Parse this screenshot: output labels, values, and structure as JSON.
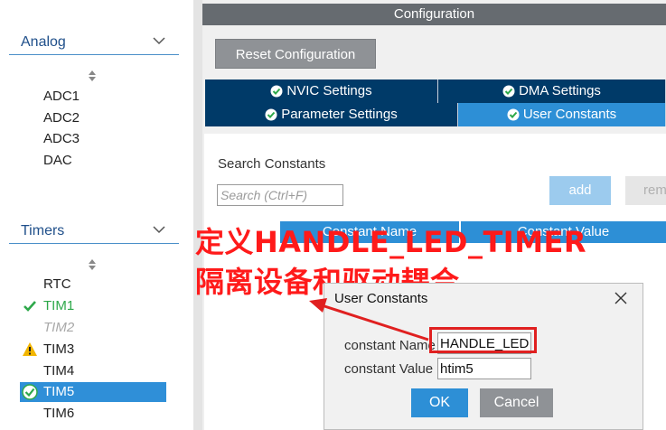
{
  "sidebar": {
    "analog": {
      "label": "Analog",
      "items": [
        "ADC1",
        "ADC2",
        "ADC3",
        "DAC"
      ]
    },
    "timers": {
      "label": "Timers",
      "items": [
        {
          "label": "RTC",
          "status": "none"
        },
        {
          "label": "TIM1",
          "status": "ok"
        },
        {
          "label": "TIM2",
          "status": "disabled"
        },
        {
          "label": "TIM3",
          "status": "warning"
        },
        {
          "label": "TIM4",
          "status": "none"
        },
        {
          "label": "TIM5",
          "status": "ok-selected"
        },
        {
          "label": "TIM6",
          "status": "none"
        }
      ]
    }
  },
  "config": {
    "title": "Configuration",
    "reset_label": "Reset Configuration",
    "tabs": [
      {
        "label": "NVIC Settings",
        "active": false
      },
      {
        "label": "DMA Settings",
        "active": false
      },
      {
        "label": "Parameter Settings",
        "active": false
      },
      {
        "label": "User Constants",
        "active": true
      }
    ],
    "search_label": "Search Constants",
    "search_placeholder": "Search (Ctrl+F)",
    "add_label": "add",
    "remove_label": "remove",
    "columns": [
      "Constant Name",
      "Constant Value"
    ]
  },
  "annotation": {
    "line1": "定义HANDLE_LED_TIMER",
    "line2": "隔离设备和驱动耦合",
    "color": "#ff1a1a"
  },
  "dialog": {
    "title": "User Constants",
    "name_label": "constant Name",
    "name_value": "HANDLE_LED_TIMER",
    "value_label": "constant Value",
    "value_value": "htim5",
    "ok_label": "OK",
    "cancel_label": "Cancel"
  },
  "colors": {
    "tab_dark": "#003a68",
    "accent": "#2d8fd6",
    "ok_green": "#2ea84a",
    "warning": "#f2b500"
  }
}
